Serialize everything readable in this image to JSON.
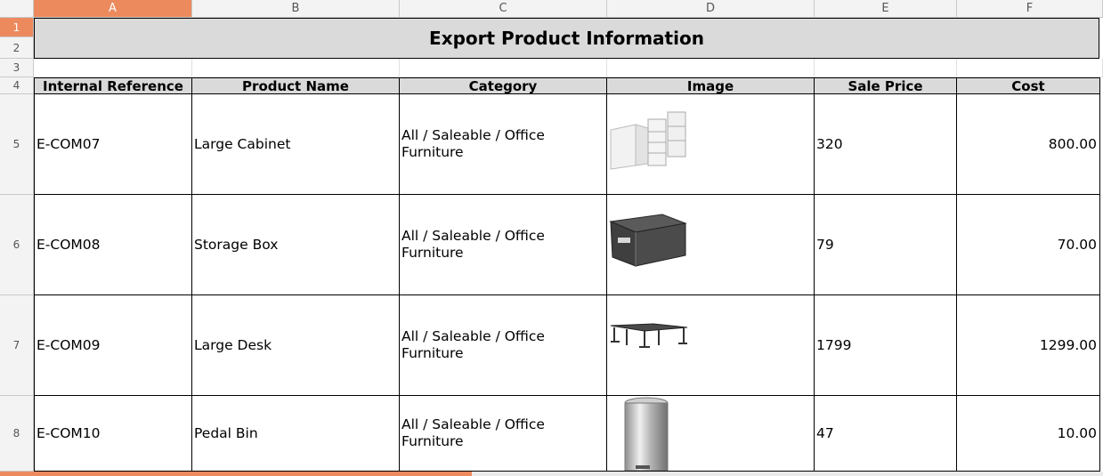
{
  "columns": [
    "A",
    "B",
    "C",
    "D",
    "E",
    "F"
  ],
  "rows": [
    "1",
    "2",
    "3",
    "4",
    "5",
    "6",
    "7",
    "8"
  ],
  "sheet_title": "Export Product Information",
  "headers": [
    "Internal Reference",
    "Product Name",
    "Category",
    "Image",
    "Sale Price",
    "Cost"
  ],
  "products": [
    {
      "ref": "E-COM07",
      "name": "Large Cabinet",
      "category": "All / Saleable / Office Furniture",
      "image": "cabinet-image",
      "sale_price": "320",
      "cost": "800.00"
    },
    {
      "ref": "E-COM08",
      "name": "Storage Box",
      "category": "All / Saleable / Office Furniture",
      "image": "storage-box-image",
      "sale_price": "79",
      "cost": "70.00"
    },
    {
      "ref": "E-COM09",
      "name": "Large Desk",
      "category": "All / Saleable / Office Furniture",
      "image": "desk-image",
      "sale_price": "1799",
      "cost": "1299.00"
    },
    {
      "ref": "E-COM10",
      "name": "Pedal Bin",
      "category": "All / Saleable / Office Furniture",
      "image": "pedal-bin-image",
      "sale_price": "47",
      "cost": "10.00"
    }
  ],
  "colors": {
    "accent": "#ec8a5e",
    "header_fill": "#dadada"
  }
}
